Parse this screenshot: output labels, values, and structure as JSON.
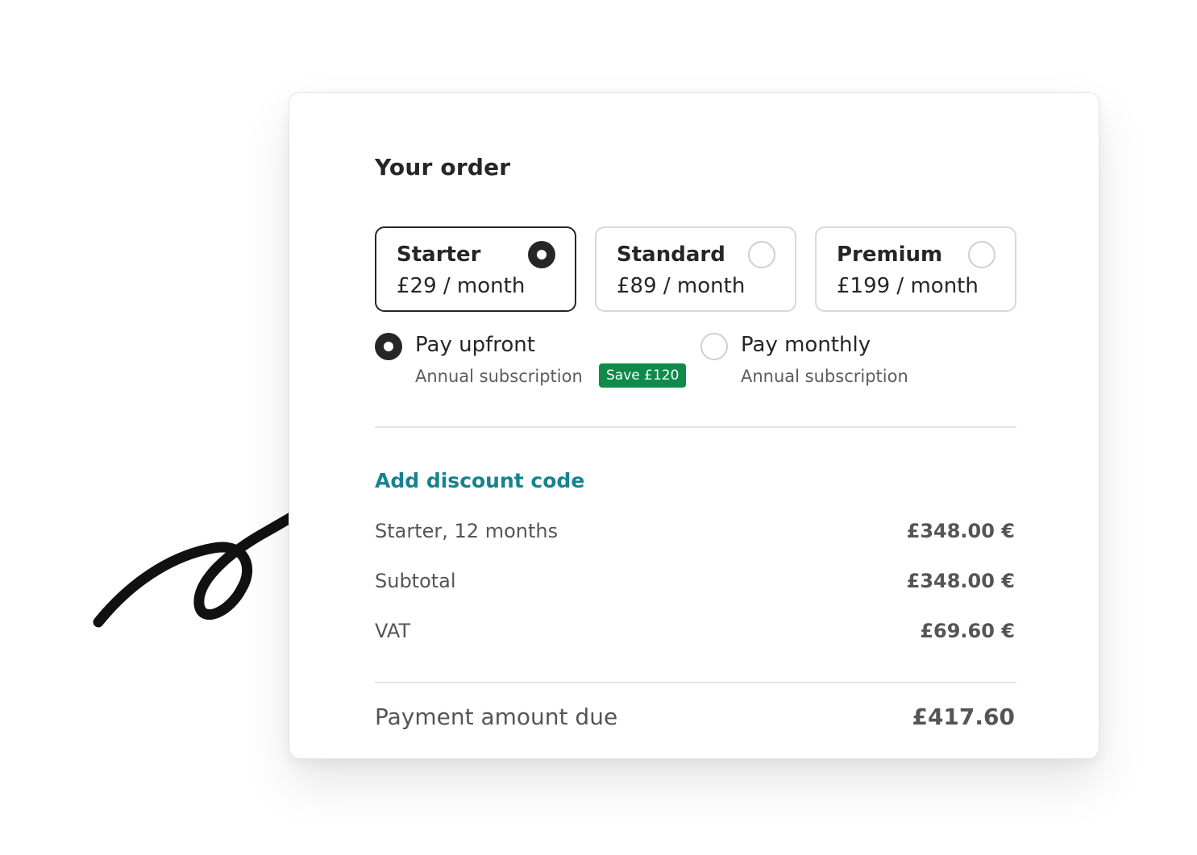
{
  "order": {
    "title": "Your order",
    "plans": [
      {
        "name": "Starter",
        "price": "£29 / month",
        "selected": true
      },
      {
        "name": "Standard",
        "price": "£89 / month",
        "selected": false
      },
      {
        "name": "Premium",
        "price": "£199 / month",
        "selected": false
      }
    ],
    "payment_options": [
      {
        "label": "Pay upfront",
        "sublabel": "Annual subscription",
        "badge": "Save £120",
        "selected": true
      },
      {
        "label": "Pay monthly",
        "sublabel": "Annual subscription",
        "selected": false
      }
    ],
    "discount_link": "Add discount code",
    "lines": [
      {
        "label": "Starter, 12 months",
        "value": "£348.00 €"
      },
      {
        "label": "Subtotal",
        "value": "£348.00 €"
      },
      {
        "label": "VAT",
        "value": "£69.60 €"
      }
    ],
    "total": {
      "label": "Payment amount due",
      "value": "£417.60"
    }
  },
  "colors": {
    "accent_link": "#16838f",
    "badge_green": "#0f8a4a",
    "text_dark": "#262626",
    "text_muted": "#555555"
  },
  "icons": {
    "annotation": "hand-drawn-arrow-icon"
  }
}
